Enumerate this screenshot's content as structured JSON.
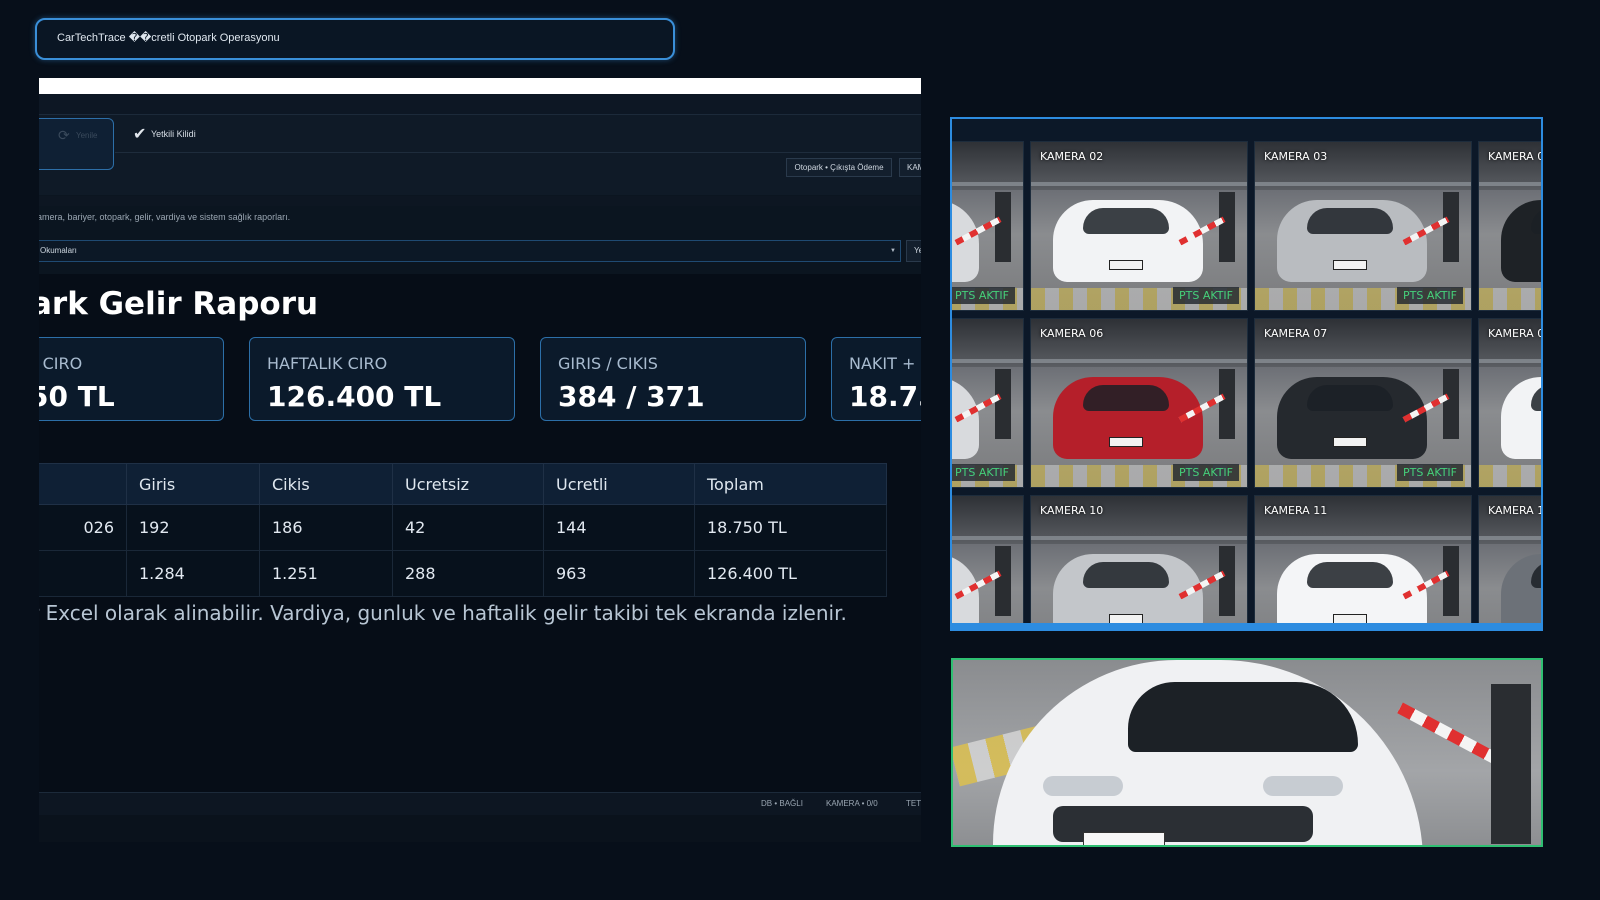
{
  "header": {
    "title": "CarTechTrace ��cretli Otopark Operasyonu"
  },
  "app": {
    "tabs": {
      "refresh_label": "Yenile",
      "check_label": "Yetkili Kilidi"
    },
    "buttons": {
      "otopark_odeme": "Otopark • Çıkışta Ödeme",
      "kam": "KAM",
      "ye": "Ye"
    },
    "description": "amera, bariyer, otopark, gelir, vardiya ve sistem sağlık raporları.",
    "report_select": {
      "value": "Okumaları"
    },
    "report_title": "ark Gelir Raporu",
    "kpis": [
      {
        "label": "K CIRO",
        "value": "50 TL"
      },
      {
        "label": "HAFTALIK CIRO",
        "value": "126.400 TL"
      },
      {
        "label": "GIRIS / CIKIS",
        "value": "384 / 371"
      },
      {
        "label": "NAKIT +",
        "value": "18.75"
      }
    ],
    "table": {
      "headers": [
        "",
        "Giris",
        "Cikis",
        "Ucretsiz",
        "Ucretli",
        "Toplam"
      ],
      "rows": [
        [
          "026",
          "192",
          "186",
          "42",
          "144",
          "18.750 TL"
        ],
        [
          "",
          "1.284",
          "1.251",
          "288",
          "963",
          "126.400 TL"
        ]
      ]
    },
    "footnote": "r Excel olarak alinabilir. Vardiya, gunluk ve haftalik gelir takibi tek ekranda izlenir.",
    "status": {
      "db": "DB • BAĞLI",
      "camera": "KAMERA • 0/0",
      "tet": "TET"
    }
  },
  "cameras": {
    "badge": "PTS AKTIF",
    "tiles": [
      {
        "label": "",
        "badge": true,
        "color": "#d8dadd"
      },
      {
        "label": "KAMERA 02",
        "badge": true,
        "color": "#f2f3f5"
      },
      {
        "label": "KAMERA 03",
        "badge": true,
        "color": "#b9bcc0"
      },
      {
        "label": "KAMERA 0",
        "badge": false,
        "color": "#1e2226"
      },
      {
        "label": "",
        "badge": true,
        "color": "#d8dadd"
      },
      {
        "label": "KAMERA 06",
        "badge": true,
        "color": "#b51f2a"
      },
      {
        "label": "KAMERA 07",
        "badge": true,
        "color": "#25292e"
      },
      {
        "label": "KAMERA 0",
        "badge": false,
        "color": "#f2f3f5"
      },
      {
        "label": "",
        "badge": false,
        "color": "#d8dadd"
      },
      {
        "label": "KAMERA 10",
        "badge": false,
        "color": "#c3c6ca"
      },
      {
        "label": "KAMERA 11",
        "badge": false,
        "color": "#f4f5f7"
      },
      {
        "label": "KAMERA 1",
        "badge": false,
        "color": "#6c7178"
      }
    ]
  }
}
